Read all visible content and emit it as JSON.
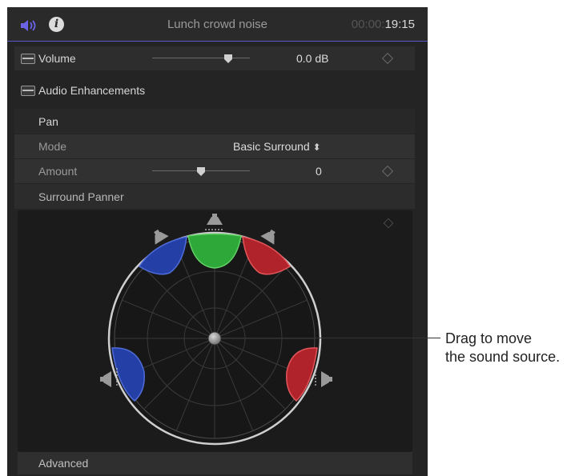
{
  "header": {
    "clip_name": "Lunch crowd noise",
    "timecode_dim": "00:00:",
    "timecode_bright": "19:15",
    "speaker_icon": "speaker-volume-icon",
    "info_icon": "info-icon",
    "info_glyph": "i"
  },
  "volume": {
    "label": "Volume",
    "value": "0.0 dB",
    "slider_fraction": 0.78
  },
  "enhancements": {
    "label": "Audio Enhancements"
  },
  "pan": {
    "label": "Pan",
    "mode_label": "Mode",
    "mode_value": "Basic Surround",
    "amount_label": "Amount",
    "amount_value": "0",
    "amount_slider_fraction": 0.5
  },
  "surround_panner": {
    "label": "Surround Panner"
  },
  "advanced": {
    "label": "Advanced"
  },
  "callout": {
    "line1": "Drag to move",
    "line2": "the sound source."
  },
  "colors": {
    "accent": "#5b55c9",
    "front_center": "#2fa83a",
    "left": "#2440a6",
    "right": "#b0232a"
  }
}
